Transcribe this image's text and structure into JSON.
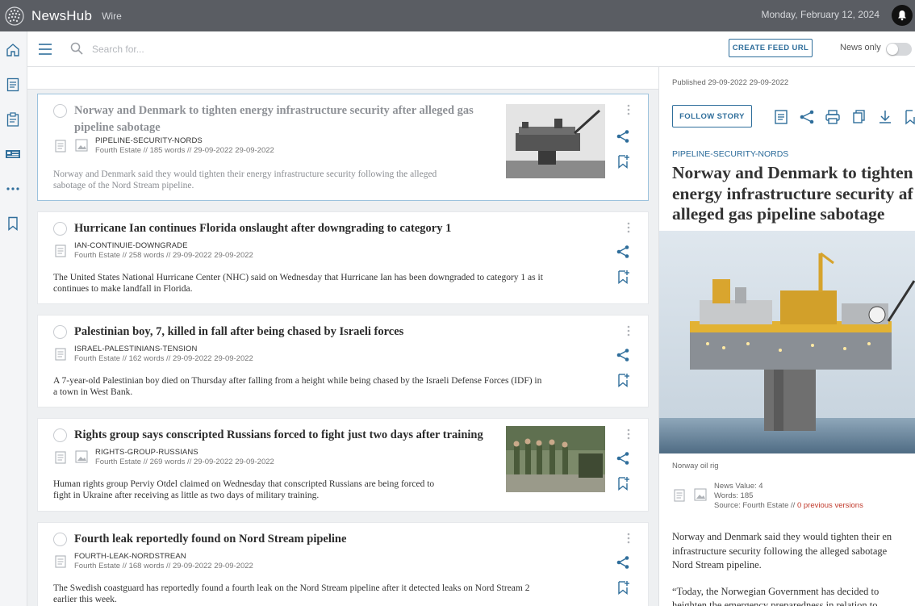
{
  "app": {
    "brand": "NewsHub",
    "section": "Wire",
    "date": "Monday, February 12, 2024"
  },
  "rail": {
    "icons": [
      "home-icon",
      "document-icon",
      "clipboard-icon",
      "newspaper-icon",
      "more-icon",
      "bookmark-icon"
    ]
  },
  "toolbar": {
    "search_placeholder": "Search for...",
    "create_feed_label": "CREATE FEED URL",
    "news_only_label": "News only",
    "news_only_enabled": false
  },
  "stories": [
    {
      "title": "Norway and Denmark to tighten energy infrastructure security after alleged gas pipeline sabotage",
      "slug": "PIPELINE-SECURITY-NORDS",
      "meta": "Fourth Estate // 185 words // 29-09-2022 29-09-2022",
      "summary_lines": [
        "Norway and Denmark said they would tighten their energy infrastructure security following the alleged",
        "sabotage of the Nord Stream pipeline."
      ],
      "has_image": true,
      "selected": true
    },
    {
      "title": "Hurricane Ian continues Florida onslaught after downgrading to category 1",
      "slug": "IAN-CONTINUIE-DOWNGRADE",
      "meta": "Fourth Estate // 258 words // 29-09-2022 29-09-2022",
      "summary_lines": [
        "The United States National Hurricane Center (NHC) said on Wednesday that Hurricane Ian has been downgraded to category 1 as it",
        "continues to make landfall in Florida."
      ],
      "has_image": false,
      "selected": false
    },
    {
      "title": "Palestinian boy, 7, killed in fall after being chased by Israeli forces",
      "slug": "ISRAEL-PALESTINIANS-TENSION",
      "meta": "Fourth Estate // 162 words // 29-09-2022 29-09-2022",
      "summary_lines": [
        "A 7-year-old Palestinian boy died on Thursday after falling from a height while being chased by the Israeli Defense Forces (IDF) in",
        "a town in West Bank."
      ],
      "has_image": false,
      "selected": false
    },
    {
      "title": "Rights group says conscripted Russians forced to fight just two days after training",
      "slug": "RIGHTS-GROUP-RUSSIANS",
      "meta": "Fourth Estate // 269 words // 29-09-2022 29-09-2022",
      "summary_lines": [
        "Human rights group Perviy Otdel claimed on Wednesday that conscripted Russians are being forced to",
        "fight in Ukraine after receiving as little as two days of military training."
      ],
      "has_image": true,
      "selected": false
    },
    {
      "title": "Fourth leak reportedly found on Nord Stream pipeline",
      "slug": "FOURTH-LEAK-NORDSTREAN",
      "meta": "Fourth Estate // 168 words // 29-09-2022 29-09-2022",
      "summary_lines": [
        "The Swedish coastguard has reportedly found a fourth leak on the Nord Stream pipeline after it detected leaks on Nord Stream 2",
        "earlier this week."
      ],
      "has_image": false,
      "selected": false
    }
  ],
  "detail": {
    "published": "Published 29-09-2022 29-09-2022",
    "follow_label": "FOLLOW STORY",
    "slug": "PIPELINE-SECURITY-NORDS",
    "title_lines": [
      "Norway and Denmark to tighten",
      "energy infrastructure security af",
      "alleged gas pipeline sabotage"
    ],
    "caption": "Norway oil rig",
    "news_value": "News Value: 4",
    "words": "Words: 185",
    "source": "Source: Fourth Estate // ",
    "versions": "0 previous versions",
    "body_lines": [
      "Norway and Denmark said they would tighten their en",
      "infrastructure security following the alleged sabotage",
      "Nord Stream pipeline.",
      "",
      "“Today, the Norwegian Government has decided to",
      "heighten the emergency preparedness in relation to"
    ]
  }
}
